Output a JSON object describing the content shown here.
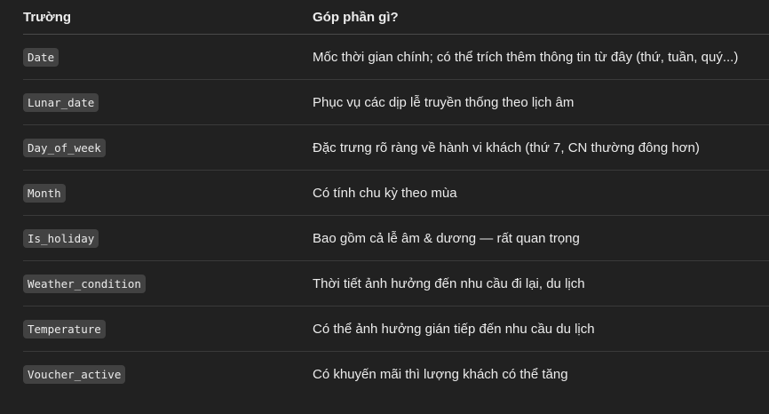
{
  "table": {
    "headers": [
      "Trường",
      "Góp phần gì?"
    ],
    "rows": [
      {
        "field": "Date",
        "desc": "Mốc thời gian chính; có thể trích thêm thông tin từ đây (thứ, tuần, quý...)"
      },
      {
        "field": "Lunar_date",
        "desc": "Phục vụ các dịp lễ truyền thống theo lịch âm"
      },
      {
        "field": "Day_of_week",
        "desc": "Đặc trưng rõ ràng về hành vi khách (thứ 7, CN thường đông hơn)"
      },
      {
        "field": "Month",
        "desc": "Có tính chu kỳ theo mùa"
      },
      {
        "field": "Is_holiday",
        "desc": "Bao gồm cả lễ âm & dương — rất quan trọng"
      },
      {
        "field": "Weather_condition",
        "desc": "Thời tiết ảnh hưởng đến nhu cầu đi lại, du lịch"
      },
      {
        "field": "Temperature",
        "desc": "Có thể ảnh hưởng gián tiếp đến nhu cầu du lịch"
      },
      {
        "field": "Voucher_active",
        "desc": "Có khuyến mãi thì lượng khách có thể tăng"
      }
    ]
  }
}
